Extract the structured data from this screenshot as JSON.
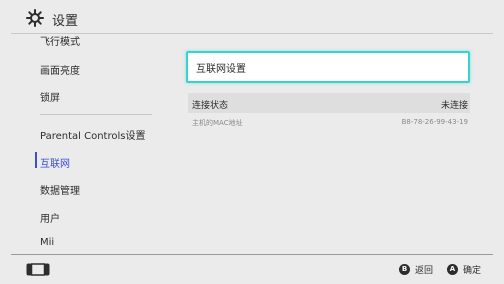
{
  "header": {
    "title": "设置",
    "icon": "gear-icon"
  },
  "sidebar": {
    "items": [
      {
        "label": "飞行模式"
      },
      {
        "label": "画面亮度"
      },
      {
        "label": "锁屏"
      },
      {
        "label": "Parental Controls设置"
      },
      {
        "label": "互联网"
      },
      {
        "label": "数据管理"
      },
      {
        "label": "用户"
      },
      {
        "label": "Mii"
      }
    ],
    "selected_index": 4
  },
  "content": {
    "internet_settings_label": "互联网设置",
    "connection_status_label": "连接状态",
    "connection_status_value": "未连接",
    "mac_label": "主机的MAC地址",
    "mac_value": "B8-78-26-99-43-19"
  },
  "footer": {
    "back_key": "B",
    "back_label": "返回",
    "confirm_key": "A",
    "confirm_label": "确定"
  },
  "colors": {
    "accent": "#3a4fd6",
    "focus_border": "#35d4d1",
    "background": "#ebebeb"
  }
}
